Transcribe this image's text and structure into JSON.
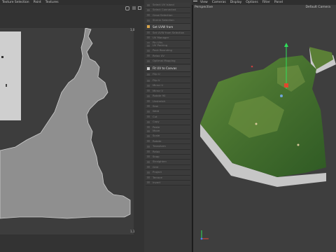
{
  "left_menu": [
    "Texture Selection",
    "Paint",
    "Textures"
  ],
  "right_menu": [
    "View",
    "Cameras",
    "Display",
    "Options",
    "Filter",
    "Panel"
  ],
  "viewport": {
    "name": "Perspective",
    "camera": "Default Camera"
  },
  "uv_view": {
    "corner_top_left": "0,0",
    "corner_top_right": "1,0",
    "corner_bottom_left": "0,1",
    "corner_bottom_right": "1,1"
  },
  "commands": {
    "group1": [
      "Select UV Island",
      "Select Connected",
      "Grow Selection",
      "Shrink Selection",
      "Set UVW from Projection...",
      "Set UVW from Selection",
      "UV Manager",
      "Pin UVs"
    ],
    "active_label": "Set UVW from Projection...",
    "group2": [
      "UV Packing",
      "Pack Bounding",
      "Relax UV",
      "Optimal Mapping"
    ],
    "fit_label": "Fit UV to Canvas",
    "group3": [
      "Flip U",
      "Flip V",
      "Mirror U",
      "Mirror V",
      "Rotate 90",
      "Unstretch",
      "Sew",
      "Weld",
      "Cut",
      "Copy",
      "Paste",
      "Align"
    ],
    "group4": [
      "Move",
      "Scale",
      "Rotate",
      "Transform",
      "Relax",
      "Snap",
      "Straighten",
      "Grid",
      "Project",
      "Terrace",
      "Invert"
    ]
  },
  "colors": {
    "background": "#2b2b2b",
    "uv_canvas": "#3d3d3d",
    "island_fill": "#8f8f8f",
    "terrain_green": "#4d7a32",
    "axis_green": "#2ee05a"
  }
}
